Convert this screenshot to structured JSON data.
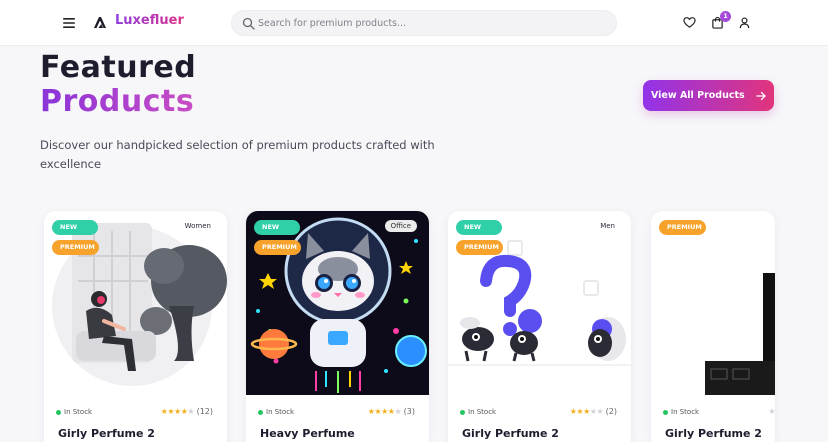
{
  "header": {
    "brand": "Luxefluer",
    "search_placeholder": "Search for premium products...",
    "cart_count": "1",
    "icons": [
      "menu-icon",
      "logo-icon",
      "search-icon",
      "heart-icon",
      "cart-icon",
      "user-icon"
    ]
  },
  "hero": {
    "title_line1": "Featured",
    "title_line2": "Products",
    "subtitle": "Discover our handpicked selection of premium products crafted with excellence",
    "view_all_label": "View All Products"
  },
  "products": [
    {
      "badges": [
        "NEW",
        "PREMIUM"
      ],
      "category": "Women",
      "stock": "In Stock",
      "rating": 4,
      "reviews": "(12)",
      "name": "Girly Perfume 2"
    },
    {
      "badges": [
        "NEW",
        "PREMIUM"
      ],
      "category": "Office",
      "stock": "In Stock",
      "rating": 4,
      "reviews": "(3)",
      "name": "Heavy Perfume"
    },
    {
      "badges": [
        "NEW",
        "PREMIUM"
      ],
      "category": "Men",
      "stock": "In Stock",
      "rating": 3,
      "reviews": "(2)",
      "name": "Girly Perfume 2"
    },
    {
      "badges": [
        "PREMIUM"
      ],
      "category": "",
      "stock": "In Stock",
      "rating": 0,
      "reviews": "",
      "name": "Girly Perfume 2"
    }
  ],
  "colors": {
    "accent_purple": "#9233ea",
    "accent_pink": "#e1347c",
    "badge_new": "#2fd0a8",
    "badge_premium": "#f7a32b",
    "in_stock": "#22c55e",
    "star": "#f2b01e"
  }
}
